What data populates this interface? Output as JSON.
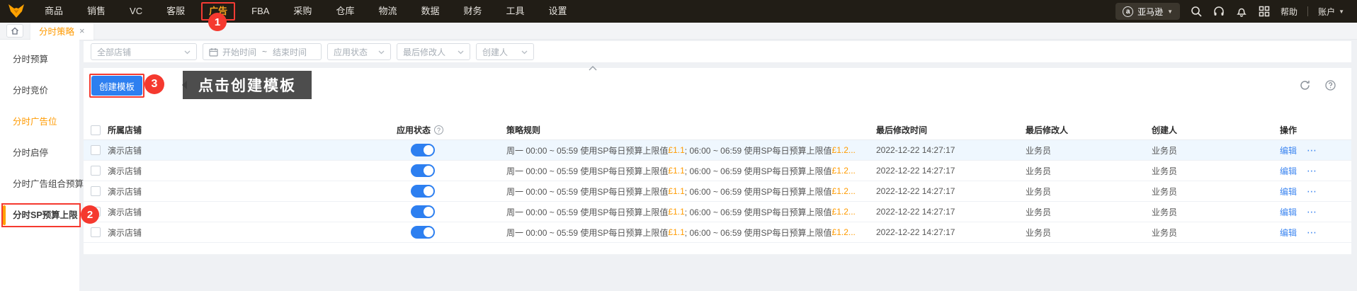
{
  "navbar": {
    "items": [
      "商品",
      "销售",
      "VC",
      "客服",
      "广告",
      "FBA",
      "采购",
      "仓库",
      "物流",
      "数据",
      "财务",
      "工具",
      "设置"
    ],
    "active_item": "广告",
    "marketplace": "亚马逊",
    "help_label": "帮助",
    "account_label": "账户"
  },
  "tabbar": {
    "active_tab": "分时策略",
    "close_glyph": "×"
  },
  "sidebar": {
    "items": [
      {
        "label": "分时预算",
        "highlighted": false,
        "selected": false
      },
      {
        "label": "分时竞价",
        "highlighted": false,
        "selected": false
      },
      {
        "label": "分时广告位",
        "highlighted": true,
        "selected": false
      },
      {
        "label": "分时启停",
        "highlighted": false,
        "selected": false
      },
      {
        "label": "分时广告组合预算",
        "highlighted": false,
        "selected": false
      },
      {
        "label": "分时SP预算上限",
        "highlighted": false,
        "selected": true
      }
    ]
  },
  "annotations": {
    "step1": "1",
    "step2": "2",
    "step3": "3",
    "color": "#f5392f"
  },
  "filters": {
    "shop_placeholder": "全部店铺",
    "date_start_placeholder": "开始时间",
    "date_separator": "~",
    "date_end_placeholder": "结束时间",
    "status_placeholder": "应用状态",
    "modifier_placeholder": "最后修改人",
    "creator_placeholder": "创建人"
  },
  "toolbar": {
    "create_button_label": "创建模板",
    "tooltip_text": "点击创建模板"
  },
  "table": {
    "headers": {
      "shop": "所属店铺",
      "status": "应用状态",
      "rule": "策略规则",
      "modified_time": "最后修改时间",
      "modifier": "最后修改人",
      "creator": "创建人",
      "actions": "操作"
    },
    "rows": [
      {
        "shop": "演示店铺",
        "status_on": true,
        "rule_parts": [
          {
            "text": "周一 00:00 ~ 05:59 使用SP每日预算上限值 ",
            "highlight": false
          },
          {
            "text": "£1.1",
            "highlight": true
          },
          {
            "text": "; 06:00 ~ 06:59 使用SP每日预算上限值 ",
            "highlight": false
          },
          {
            "text": "£1.2...",
            "highlight": true
          }
        ],
        "modified_time": "2022-12-22 14:27:17",
        "modifier": "业务员",
        "creator": "业务员",
        "actions": {
          "edit": "编辑",
          "more": "⋯"
        }
      },
      {
        "shop": "演示店铺",
        "status_on": true,
        "rule_parts": [
          {
            "text": "周一 00:00 ~ 05:59 使用SP每日预算上限值 ",
            "highlight": false
          },
          {
            "text": "£1.1",
            "highlight": true
          },
          {
            "text": "; 06:00 ~ 06:59 使用SP每日预算上限值 ",
            "highlight": false
          },
          {
            "text": "£1.2...",
            "highlight": true
          }
        ],
        "modified_time": "2022-12-22 14:27:17",
        "modifier": "业务员",
        "creator": "业务员",
        "actions": {
          "edit": "编辑",
          "more": "⋯"
        }
      },
      {
        "shop": "演示店铺",
        "status_on": true,
        "rule_parts": [
          {
            "text": "周一 00:00 ~ 05:59 使用SP每日预算上限值 ",
            "highlight": false
          },
          {
            "text": "£1.1",
            "highlight": true
          },
          {
            "text": "; 06:00 ~ 06:59 使用SP每日预算上限值 ",
            "highlight": false
          },
          {
            "text": "£1.2...",
            "highlight": true
          }
        ],
        "modified_time": "2022-12-22 14:27:17",
        "modifier": "业务员",
        "creator": "业务员",
        "actions": {
          "edit": "编辑",
          "more": "⋯"
        }
      },
      {
        "shop": "演示店铺",
        "status_on": true,
        "rule_parts": [
          {
            "text": "周一 00:00 ~ 05:59 使用SP每日预算上限值 ",
            "highlight": false
          },
          {
            "text": "£1.1",
            "highlight": true
          },
          {
            "text": "; 06:00 ~ 06:59 使用SP每日预算上限值 ",
            "highlight": false
          },
          {
            "text": "£1.2...",
            "highlight": true
          }
        ],
        "modified_time": "2022-12-22 14:27:17",
        "modifier": "业务员",
        "creator": "业务员",
        "actions": {
          "edit": "编辑",
          "more": "⋯"
        }
      },
      {
        "shop": "演示店铺",
        "status_on": true,
        "rule_parts": [
          {
            "text": "周一 00:00 ~ 05:59 使用SP每日预算上限值 ",
            "highlight": false
          },
          {
            "text": "£1.1",
            "highlight": true
          },
          {
            "text": "; 06:00 ~ 06:59 使用SP每日预算上限值 ",
            "highlight": false
          },
          {
            "text": "£1.2...",
            "highlight": true
          }
        ],
        "modified_time": "2022-12-22 14:27:17",
        "modifier": "业务员",
        "creator": "业务员",
        "actions": {
          "edit": "编辑",
          "more": "⋯"
        }
      }
    ]
  },
  "colors": {
    "accent_orange": "#ff9a00",
    "primary_blue": "#2d7ff0",
    "annotation_red": "#f5392f",
    "currency_orange": "#ff9b00",
    "nav_bg": "#211d16"
  }
}
